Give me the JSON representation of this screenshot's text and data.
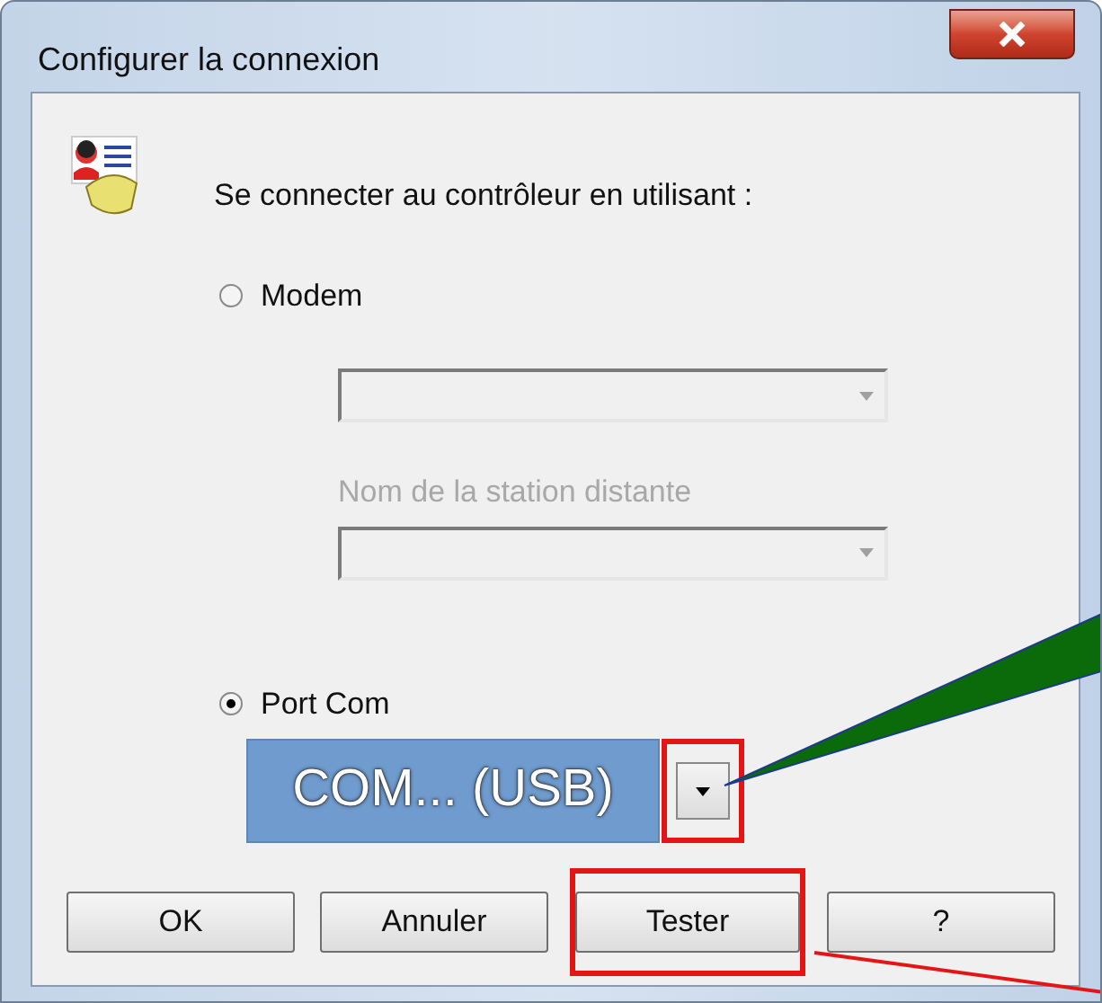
{
  "window": {
    "title": "Configurer la connexion"
  },
  "prompt": "Se connecter au contrôleur en utilisant :",
  "options": [
    {
      "label": "Modem",
      "selected": false
    },
    {
      "label": "Port Com",
      "selected": true
    }
  ],
  "modem_fields": {
    "station_label": "Nom de la station distante",
    "disabled": true
  },
  "port_combo": {
    "annotation": "COM... (USB)",
    "highlighted": true
  },
  "buttons": [
    {
      "label": "OK",
      "highlighted": false
    },
    {
      "label": "Annuler",
      "highlighted": false
    },
    {
      "label": "Tester",
      "highlighted": true
    },
    {
      "label": "?",
      "highlighted": false
    }
  ]
}
